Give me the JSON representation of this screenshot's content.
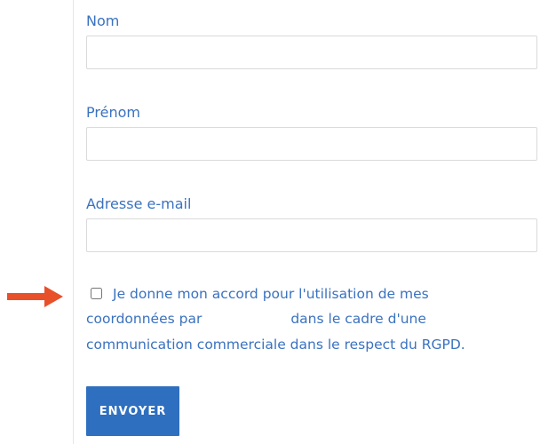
{
  "form": {
    "fields": [
      {
        "label": "Nom",
        "value": ""
      },
      {
        "label": "Prénom",
        "value": ""
      },
      {
        "label": "Adresse e-mail",
        "value": ""
      }
    ],
    "consent": {
      "checked": false,
      "line1": "Je donne mon accord pour l'utilisation de mes",
      "line2_start": "coordonnées par",
      "line2_end": "dans le cadre d'une",
      "line3": "communication commerciale dans le respect du RGPD."
    },
    "submit_label": "ENVOYER"
  },
  "annotation": {
    "arrow_color": "#e8502a",
    "icon": "arrow-right-icon"
  },
  "colors": {
    "accent": "#2e6fbf",
    "label_text": "#3a72c0"
  }
}
